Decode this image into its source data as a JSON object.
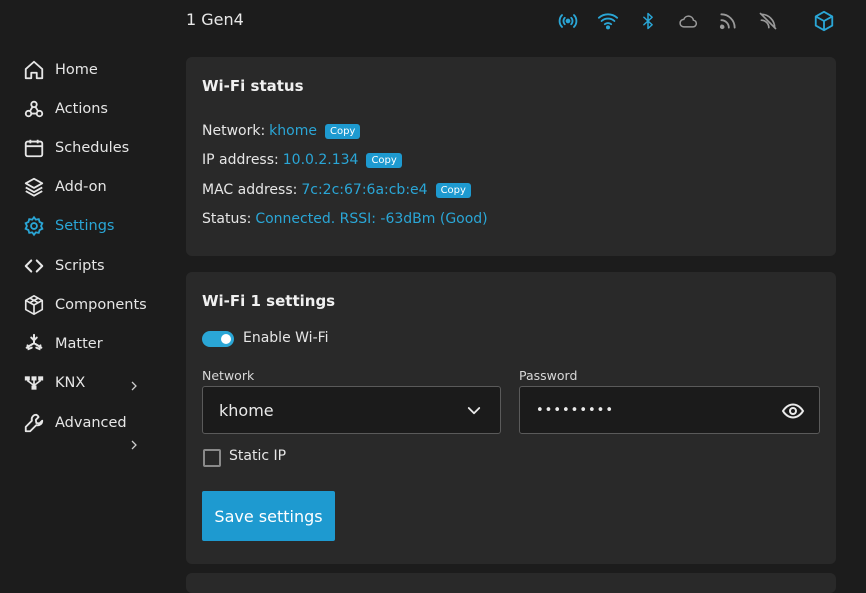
{
  "header": {
    "device_title": "1 Gen4",
    "icons": [
      "access-point-icon",
      "wifi-icon",
      "bluetooth-icon",
      "cloud-icon",
      "rss-icon",
      "no-link-icon",
      "cube-icon"
    ]
  },
  "sidebar": {
    "items": [
      {
        "label": "Home",
        "icon": "home-icon"
      },
      {
        "label": "Actions",
        "icon": "actions-icon"
      },
      {
        "label": "Schedules",
        "icon": "calendar-icon"
      },
      {
        "label": "Add-on",
        "icon": "layers-icon"
      },
      {
        "label": "Settings",
        "icon": "gear-icon",
        "active": true
      },
      {
        "label": "Scripts",
        "icon": "code-icon"
      },
      {
        "label": "Components",
        "icon": "components-icon"
      },
      {
        "label": "Matter",
        "icon": "matter-icon"
      },
      {
        "label": "KNX",
        "icon": "knx-icon"
      },
      {
        "label": "Advanced",
        "icon": "wrench-icon"
      }
    ]
  },
  "wifi_status": {
    "title": "Wi-Fi status",
    "network_label": "Network:",
    "network_value": "khome",
    "ip_label": "IP address:",
    "ip_value": "10.0.2.134",
    "mac_label": "MAC address:",
    "mac_value": "7c:2c:67:6a:cb:e4",
    "status_label": "Status:",
    "status_value": "Connected. RSSI: -63dBm (Good)",
    "copy_label": "Copy"
  },
  "wifi1_settings": {
    "title": "Wi-Fi 1 settings",
    "enable_label": "Enable Wi-Fi",
    "enabled": true,
    "network_field_label": "Network",
    "network_value": "khome",
    "password_field_label": "Password",
    "password_value": "•••••••••",
    "static_ip_label": "Static IP",
    "static_ip_checked": false,
    "save_label": "Save settings"
  },
  "colors": {
    "accent": "#2aa6d6",
    "card": "#292929",
    "background": "#1c1c1c",
    "button": "#1e9ad0"
  }
}
